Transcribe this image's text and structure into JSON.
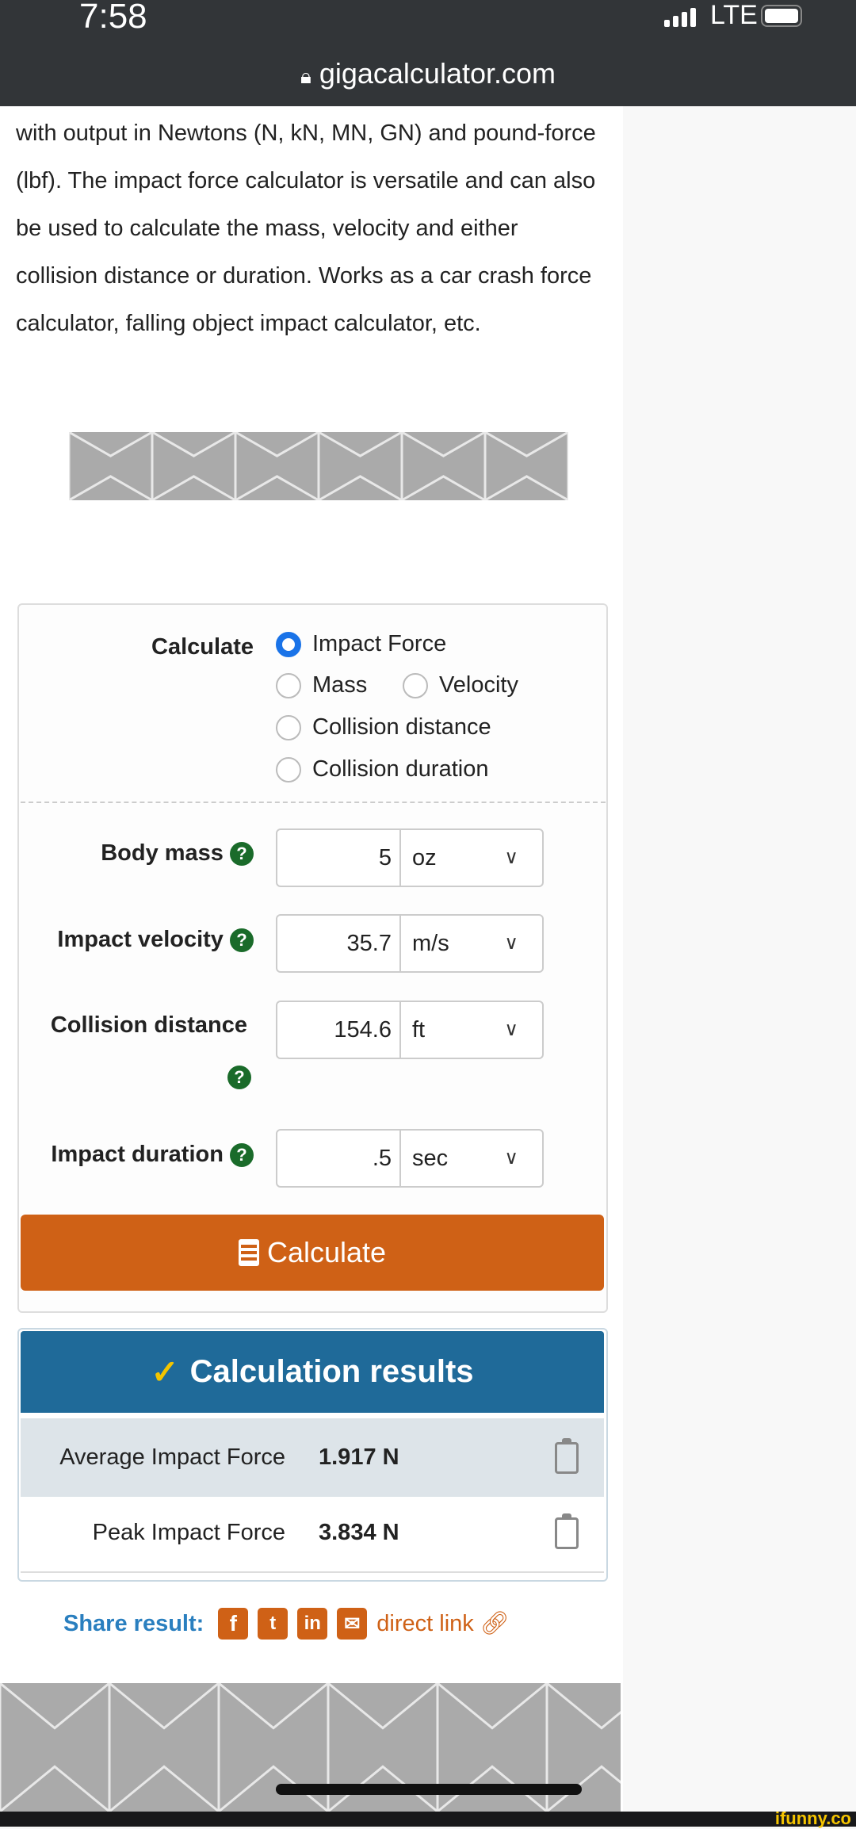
{
  "status_bar": {
    "time": "7:58",
    "network": "LTE"
  },
  "browser": {
    "url": "gigacalculator.com"
  },
  "intro_text": "with output in Newtons (N, kN, MN, GN) and pound-force (lbf). The impact force calculator is versatile and can also be used to calculate the mass, velocity and either collision distance or duration. Works as a car crash force calculator, falling object impact calculator, etc.",
  "form": {
    "calculate_label": "Calculate",
    "options": [
      {
        "label": "Impact Force",
        "selected": true
      },
      {
        "label": "Mass",
        "selected": false
      },
      {
        "label": "Velocity",
        "selected": false
      },
      {
        "label": "Collision distance",
        "selected": false
      },
      {
        "label": "Collision duration",
        "selected": false
      }
    ],
    "fields": [
      {
        "label": "Body mass",
        "value": "5",
        "unit": "oz"
      },
      {
        "label": "Impact velocity",
        "value": "35.7",
        "unit": "m/s"
      },
      {
        "label": "Collision distance",
        "value": "154.6",
        "unit": "ft"
      },
      {
        "label": "Impact duration",
        "value": ".5",
        "unit": "sec"
      }
    ],
    "help_glyph": "?",
    "calculate_button": "Calculate"
  },
  "results": {
    "title": "Calculation results",
    "rows": [
      {
        "label": "Average Impact Force",
        "value": "1.917 N"
      },
      {
        "label": "Peak Impact Force",
        "value": "3.834 N"
      }
    ]
  },
  "share": {
    "label": "Share result:",
    "direct_link": "direct link"
  },
  "watermark": "ifunny.co",
  "colors": {
    "accent_orange": "#cf6116",
    "results_blue": "#1f6a99",
    "radio_blue": "#1a73e8",
    "help_green": "#1a6b2a"
  }
}
